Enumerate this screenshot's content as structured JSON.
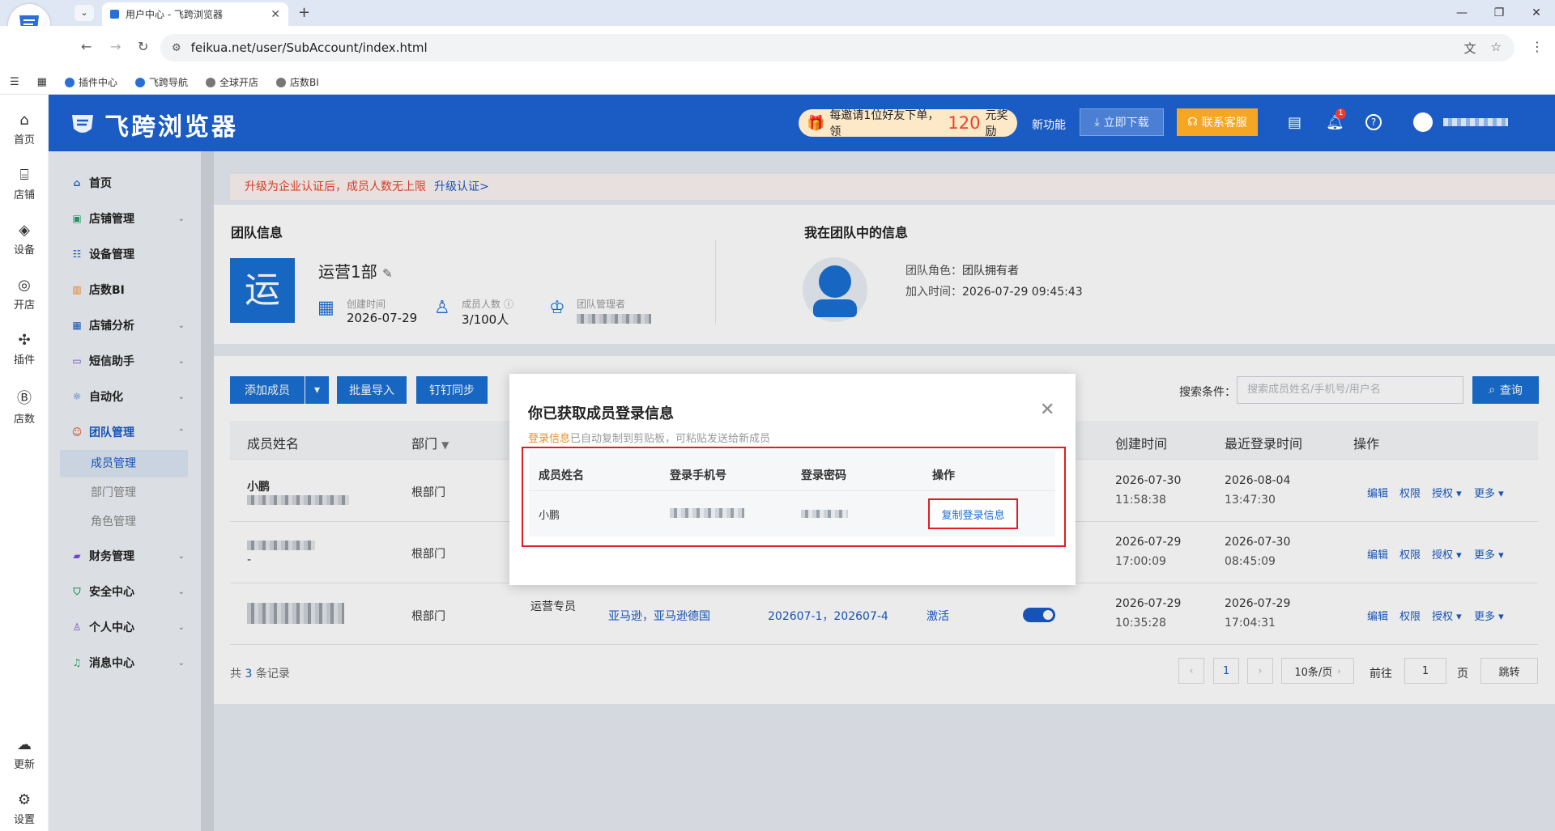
{
  "browser": {
    "tab_title": "用户中心 - 飞跨浏览器",
    "url": "feikua.net/user/SubAccount/index.html",
    "bookmarks": [
      "插件中心",
      "飞跨导航",
      "全球开店",
      "店数BI"
    ],
    "tab_close": "✕",
    "new_tab": "+",
    "window_controls": [
      "—",
      "❐",
      "✕"
    ]
  },
  "header": {
    "logo": "飞跨浏览器",
    "promo_text": "每邀请1位好友下单，领",
    "promo_amount": "120",
    "promo_suffix": "元奖励",
    "new_features": "新功能",
    "download": "立即下载",
    "contact": "联系客服",
    "notif_count": "1"
  },
  "rail": [
    "首页",
    "店铺",
    "设备",
    "开店",
    "插件",
    "店数",
    "更新",
    "设置"
  ],
  "sidebar": {
    "items": [
      "首页",
      "店铺管理",
      "设备管理",
      "店数BI",
      "店铺分析",
      "短信助手",
      "自动化",
      "团队管理",
      "财务管理",
      "安全中心",
      "个人中心",
      "消息中心"
    ],
    "sub_items": [
      "成员管理",
      "部门管理",
      "角色管理"
    ]
  },
  "notice": {
    "text": "升级为企业认证后，成员人数无上限",
    "link": "升级认证>"
  },
  "team": {
    "section_title": "团队信息",
    "icon_char": "运",
    "name": "运营1部",
    "created_label": "创建时间",
    "created_value": "2026-07-29",
    "members_label": "成员人数",
    "members_value": "3/100人",
    "manager_label": "团队管理者"
  },
  "my_info": {
    "section_title": "我在团队中的信息",
    "role_label": "团队角色：",
    "role_value": "团队拥有者",
    "join_label": "加入时间：",
    "join_value": "2026-07-29 09:45:43"
  },
  "toolbar": {
    "add_member": "添加成员",
    "batch_import": "批量导入",
    "dingtalk_sync": "钉钉同步",
    "search_label": "搜索条件：",
    "search_placeholder": "搜索成员姓名/手机号/用户名",
    "query": "查询"
  },
  "table": {
    "headers": {
      "name": "成员姓名",
      "dept": "部门",
      "created": "创建时间",
      "last_login": "最近登录时间",
      "ops": "操作"
    },
    "rows": [
      {
        "name": "小鹏",
        "dept": "根部门",
        "created_date": "2026-07-30",
        "created_time": "11:58:38",
        "login_date": "2026-08-04",
        "login_time": "13:47:30"
      },
      {
        "name": "",
        "sub": "-",
        "dept": "根部门",
        "created_date": "2026-07-29",
        "created_time": "17:00:09",
        "login_date": "2026-07-30",
        "login_time": "08:45:09"
      },
      {
        "name": "",
        "dept": "根部门",
        "role": "运营专员",
        "shops": "亚马逊，亚马逊德国",
        "groups": "202607-1，202607-4",
        "status": "激活",
        "created_date": "2026-07-29",
        "created_time": "10:35:28",
        "login_date": "2026-07-29",
        "login_time": "17:04:31"
      }
    ],
    "row_ops": [
      "编辑",
      "权限",
      "授权 ▾",
      "更多 ▾"
    ]
  },
  "pagination": {
    "total_prefix": "共",
    "total": "3",
    "total_suffix": "条记录",
    "current_page": "1",
    "page_size": "10条/页",
    "goto_label": "前往",
    "goto_value": "1",
    "page_unit": "页",
    "jump": "跳转"
  },
  "modal": {
    "title": "你已获取成员登录信息",
    "tip_highlight": "登录信息",
    "tip_rest": "已自动复制到剪贴板，可粘贴发送给新成员",
    "headers": [
      "成员姓名",
      "登录手机号",
      "登录密码",
      "操作"
    ],
    "row_name": "小鹏",
    "copy_button": "复制登录信息",
    "close": "✕"
  },
  "colors": {
    "brand": "#1a5bc4",
    "accent_orange": "#f5a623",
    "danger": "#e21c26"
  }
}
